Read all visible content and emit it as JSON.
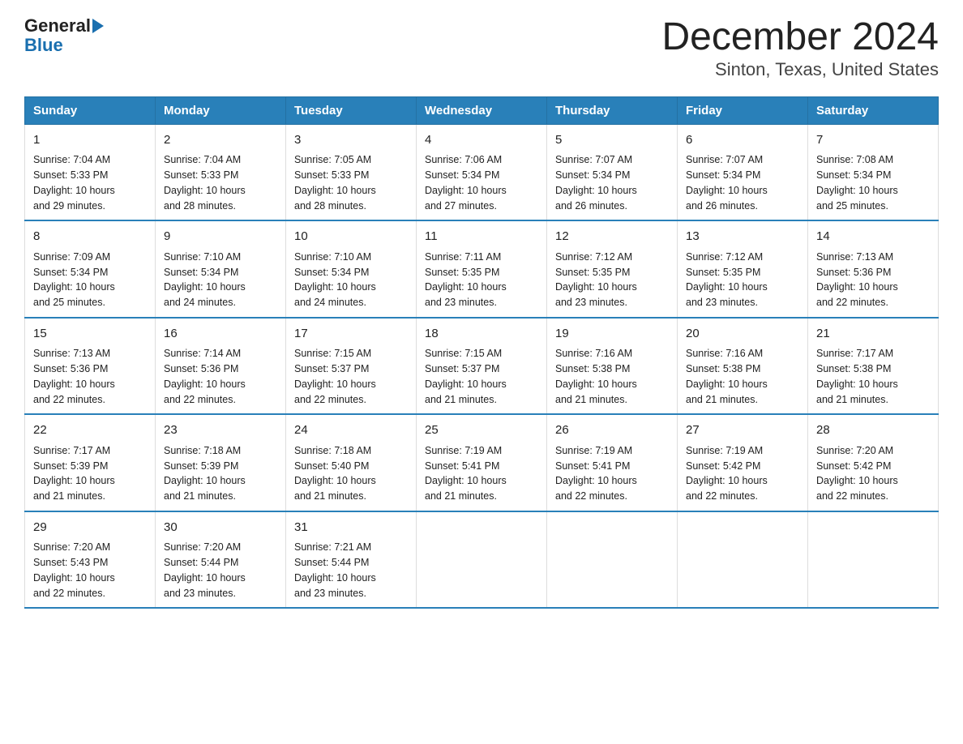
{
  "header": {
    "logo": {
      "line1": "General",
      "triangle": "▶",
      "line2": "Blue"
    },
    "title": "December 2024",
    "subtitle": "Sinton, Texas, United States"
  },
  "days_of_week": [
    "Sunday",
    "Monday",
    "Tuesday",
    "Wednesday",
    "Thursday",
    "Friday",
    "Saturday"
  ],
  "weeks": [
    [
      {
        "num": "1",
        "sunrise": "7:04 AM",
        "sunset": "5:33 PM",
        "daylight": "10 hours and 29 minutes."
      },
      {
        "num": "2",
        "sunrise": "7:04 AM",
        "sunset": "5:33 PM",
        "daylight": "10 hours and 28 minutes."
      },
      {
        "num": "3",
        "sunrise": "7:05 AM",
        "sunset": "5:33 PM",
        "daylight": "10 hours and 28 minutes."
      },
      {
        "num": "4",
        "sunrise": "7:06 AM",
        "sunset": "5:34 PM",
        "daylight": "10 hours and 27 minutes."
      },
      {
        "num": "5",
        "sunrise": "7:07 AM",
        "sunset": "5:34 PM",
        "daylight": "10 hours and 26 minutes."
      },
      {
        "num": "6",
        "sunrise": "7:07 AM",
        "sunset": "5:34 PM",
        "daylight": "10 hours and 26 minutes."
      },
      {
        "num": "7",
        "sunrise": "7:08 AM",
        "sunset": "5:34 PM",
        "daylight": "10 hours and 25 minutes."
      }
    ],
    [
      {
        "num": "8",
        "sunrise": "7:09 AM",
        "sunset": "5:34 PM",
        "daylight": "10 hours and 25 minutes."
      },
      {
        "num": "9",
        "sunrise": "7:10 AM",
        "sunset": "5:34 PM",
        "daylight": "10 hours and 24 minutes."
      },
      {
        "num": "10",
        "sunrise": "7:10 AM",
        "sunset": "5:34 PM",
        "daylight": "10 hours and 24 minutes."
      },
      {
        "num": "11",
        "sunrise": "7:11 AM",
        "sunset": "5:35 PM",
        "daylight": "10 hours and 23 minutes."
      },
      {
        "num": "12",
        "sunrise": "7:12 AM",
        "sunset": "5:35 PM",
        "daylight": "10 hours and 23 minutes."
      },
      {
        "num": "13",
        "sunrise": "7:12 AM",
        "sunset": "5:35 PM",
        "daylight": "10 hours and 23 minutes."
      },
      {
        "num": "14",
        "sunrise": "7:13 AM",
        "sunset": "5:36 PM",
        "daylight": "10 hours and 22 minutes."
      }
    ],
    [
      {
        "num": "15",
        "sunrise": "7:13 AM",
        "sunset": "5:36 PM",
        "daylight": "10 hours and 22 minutes."
      },
      {
        "num": "16",
        "sunrise": "7:14 AM",
        "sunset": "5:36 PM",
        "daylight": "10 hours and 22 minutes."
      },
      {
        "num": "17",
        "sunrise": "7:15 AM",
        "sunset": "5:37 PM",
        "daylight": "10 hours and 22 minutes."
      },
      {
        "num": "18",
        "sunrise": "7:15 AM",
        "sunset": "5:37 PM",
        "daylight": "10 hours and 21 minutes."
      },
      {
        "num": "19",
        "sunrise": "7:16 AM",
        "sunset": "5:38 PM",
        "daylight": "10 hours and 21 minutes."
      },
      {
        "num": "20",
        "sunrise": "7:16 AM",
        "sunset": "5:38 PM",
        "daylight": "10 hours and 21 minutes."
      },
      {
        "num": "21",
        "sunrise": "7:17 AM",
        "sunset": "5:38 PM",
        "daylight": "10 hours and 21 minutes."
      }
    ],
    [
      {
        "num": "22",
        "sunrise": "7:17 AM",
        "sunset": "5:39 PM",
        "daylight": "10 hours and 21 minutes."
      },
      {
        "num": "23",
        "sunrise": "7:18 AM",
        "sunset": "5:39 PM",
        "daylight": "10 hours and 21 minutes."
      },
      {
        "num": "24",
        "sunrise": "7:18 AM",
        "sunset": "5:40 PM",
        "daylight": "10 hours and 21 minutes."
      },
      {
        "num": "25",
        "sunrise": "7:19 AM",
        "sunset": "5:41 PM",
        "daylight": "10 hours and 21 minutes."
      },
      {
        "num": "26",
        "sunrise": "7:19 AM",
        "sunset": "5:41 PM",
        "daylight": "10 hours and 22 minutes."
      },
      {
        "num": "27",
        "sunrise": "7:19 AM",
        "sunset": "5:42 PM",
        "daylight": "10 hours and 22 minutes."
      },
      {
        "num": "28",
        "sunrise": "7:20 AM",
        "sunset": "5:42 PM",
        "daylight": "10 hours and 22 minutes."
      }
    ],
    [
      {
        "num": "29",
        "sunrise": "7:20 AM",
        "sunset": "5:43 PM",
        "daylight": "10 hours and 22 minutes."
      },
      {
        "num": "30",
        "sunrise": "7:20 AM",
        "sunset": "5:44 PM",
        "daylight": "10 hours and 23 minutes."
      },
      {
        "num": "31",
        "sunrise": "7:21 AM",
        "sunset": "5:44 PM",
        "daylight": "10 hours and 23 minutes."
      },
      null,
      null,
      null,
      null
    ]
  ],
  "labels": {
    "sunrise": "Sunrise:",
    "sunset": "Sunset:",
    "daylight": "Daylight:"
  }
}
